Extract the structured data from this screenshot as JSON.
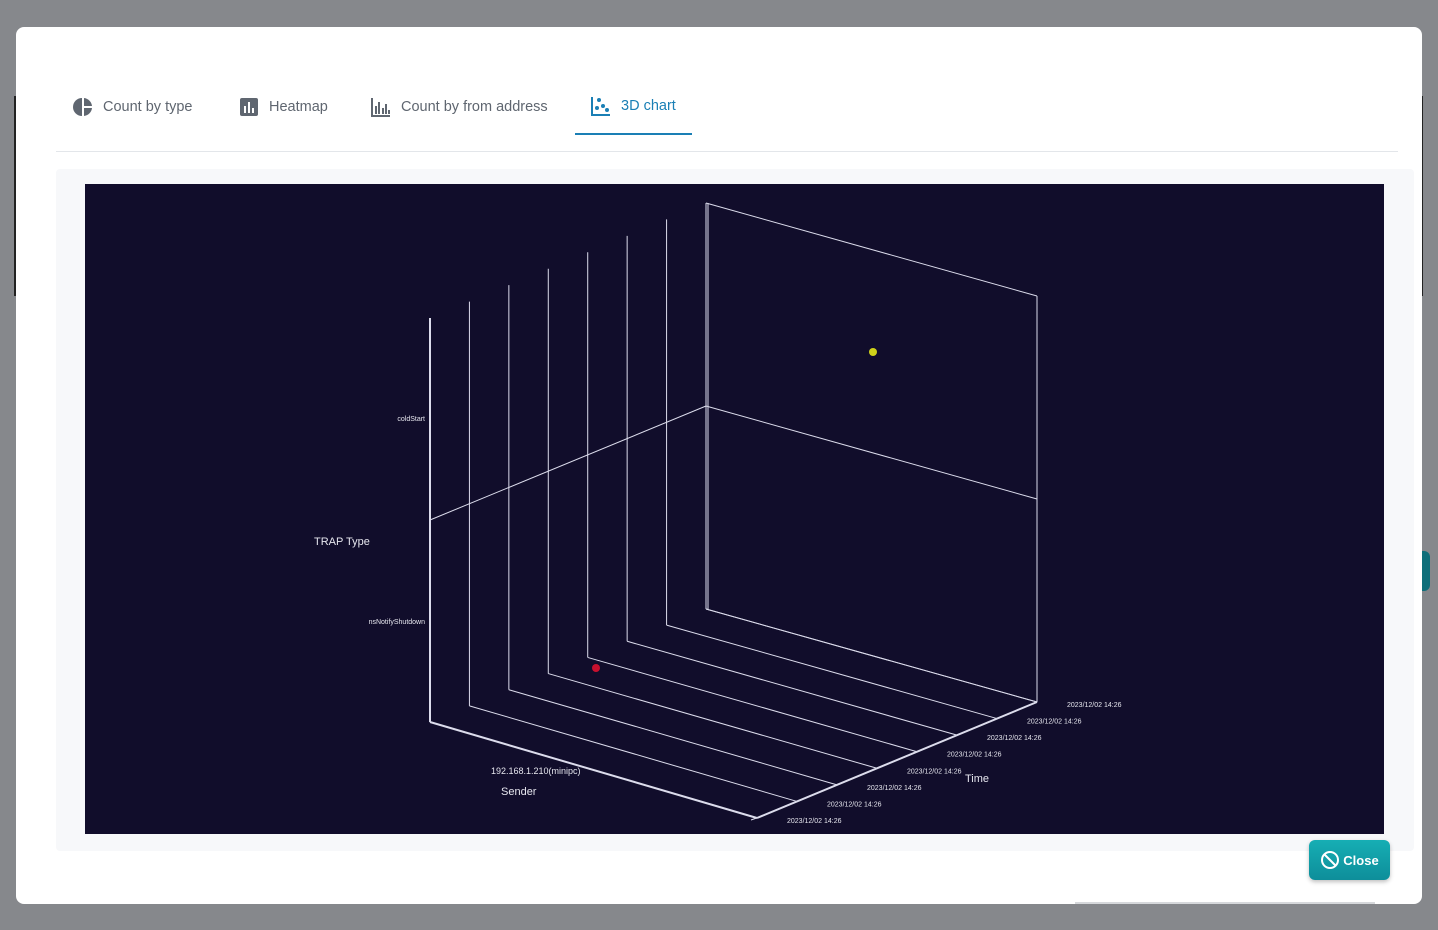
{
  "tabs": [
    {
      "label": "Count by type",
      "icon": "pie-chart-icon",
      "active": false
    },
    {
      "label": "Heatmap",
      "icon": "bar-chart-icon",
      "active": false
    },
    {
      "label": "Count by from address",
      "icon": "grouped-bar-icon",
      "active": false
    },
    {
      "label": "3D chart",
      "icon": "scatter-chart-icon",
      "active": true
    }
  ],
  "close_label": "Close",
  "colors": {
    "accent": "#1a7fb5",
    "chart_background": "#110d2b",
    "close_button": "#0e8e9a",
    "point_yellow": "#cfd11a",
    "point_red": "#c8102e"
  },
  "chart_data": {
    "type": "scatter",
    "title": "",
    "axes": {
      "x": {
        "label": "Sender",
        "ticks": [
          "192.168.1.210(minipc)"
        ]
      },
      "y": {
        "label": "TRAP Type",
        "ticks": [
          "nsNotifyShutdown",
          "coldStart"
        ]
      },
      "z": {
        "label": "Time",
        "ticks": [
          "2023/12/02 14:26",
          "2023/12/02 14:26",
          "2023/12/02 14:26",
          "2023/12/02 14:26",
          "2023/12/02 14:26",
          "2023/12/02 14:26",
          "2023/12/02 14:26",
          "2023/12/02 14:26"
        ]
      }
    },
    "points": [
      {
        "sender": "192.168.1.210(minipc)",
        "trap_type": "coldStart",
        "time": "2023/12/02 14:26",
        "color": "#cfd11a"
      },
      {
        "sender": "192.168.1.210(minipc)",
        "trap_type": "nsNotifyShutdown",
        "time": "2023/12/02 14:26",
        "color": "#c8102e"
      }
    ],
    "grid": true,
    "legend": "none"
  }
}
